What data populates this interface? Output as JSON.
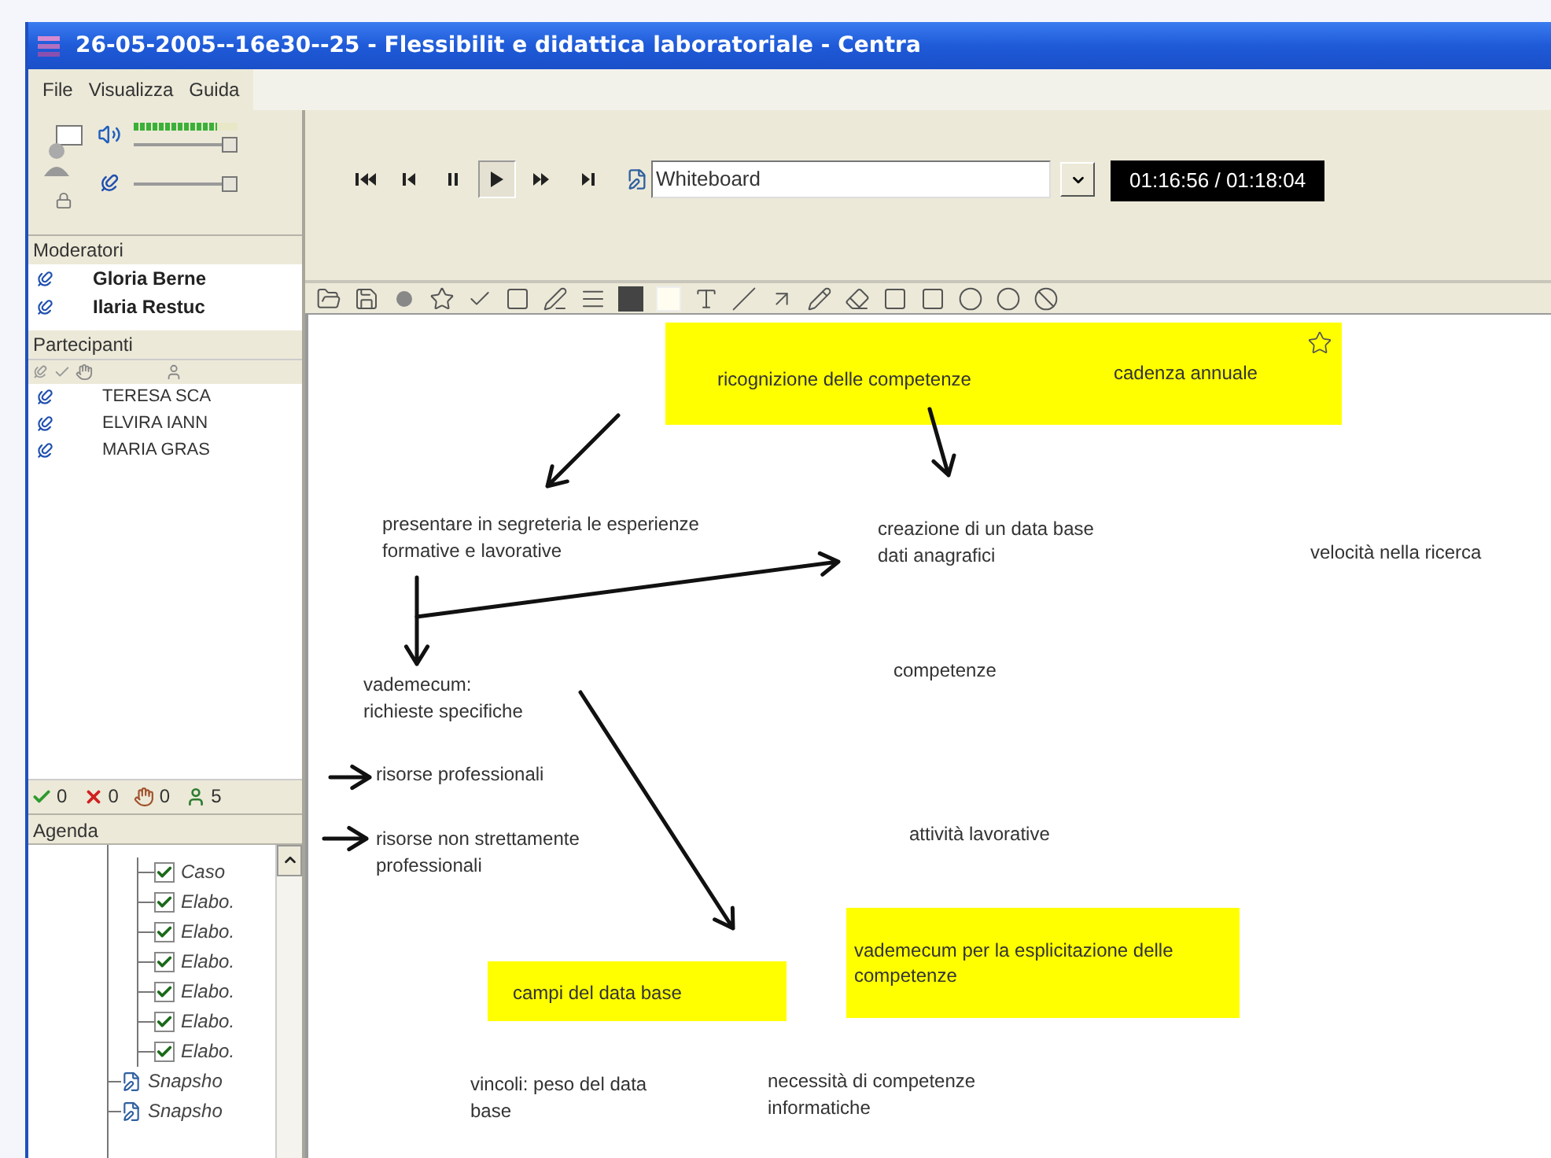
{
  "window": {
    "title": "26-05-2005--16e30--25 - Flessibilit e didattica laboratoriale - Centra"
  },
  "menu": [
    "File",
    "Visualizza",
    "Guida"
  ],
  "audio": {
    "meter": {
      "level": 0.8
    },
    "speaker": {
      "level": 1
    },
    "microphone": {
      "level": 1
    }
  },
  "moderators": {
    "title": "Moderatori",
    "items": [
      "Gloria Berne",
      "Ilaria Restuc"
    ]
  },
  "participants": {
    "title": "Partecipanti",
    "items": [
      "TERESA SCA",
      "ELVIRA IANN",
      "MARIA GRAS"
    ]
  },
  "status": [
    {
      "kind": "agree",
      "count": "0"
    },
    {
      "kind": "disagree",
      "count": "0"
    },
    {
      "kind": "hand",
      "count": "0"
    },
    {
      "kind": "people",
      "count": "5"
    }
  ],
  "agenda": {
    "title": "Agenda",
    "items": [
      {
        "kind": "group",
        "children": [
          {
            "label": "Caso",
            "checked": true
          },
          {
            "label": "Elabo.",
            "checked": true
          },
          {
            "label": "Elabo.",
            "checked": true
          },
          {
            "label": "Elabo.",
            "checked": true
          },
          {
            "label": "Elabo.",
            "checked": true
          },
          {
            "label": "Elabo.",
            "checked": true
          },
          {
            "label": "Elabo.",
            "checked": true
          }
        ]
      },
      {
        "kind": "snapshot",
        "label": "Snapsho"
      },
      {
        "kind": "snapshot",
        "label": "Snapsho"
      }
    ]
  },
  "playback": {
    "controls": [
      {
        "kind": "first",
        "selected": false
      },
      {
        "kind": "prev",
        "selected": false
      },
      {
        "kind": "pause",
        "selected": false
      },
      {
        "kind": "play",
        "selected": true
      },
      {
        "kind": "next",
        "selected": false
      },
      {
        "kind": "last",
        "selected": false
      }
    ],
    "view": {
      "value": "Whiteboard"
    },
    "time": "01:16:56 / 01:18:04"
  },
  "whiteboard": {
    "notes": [
      {
        "kind": "highlight",
        "texts": [
          "ricognizione delle competenze",
          "cadenza annuale"
        ]
      },
      {
        "kind": "text",
        "lines": [
          "presentare in segreteria le esperienze",
          "formative e lavorative"
        ]
      },
      {
        "kind": "text",
        "lines": [
          "creazione di un data base",
          "dati anagrafici"
        ]
      },
      {
        "kind": "text",
        "lines": [
          "velocità nella ricerca"
        ]
      },
      {
        "kind": "text",
        "lines": [
          "competenze"
        ]
      },
      {
        "kind": "text",
        "lines": [
          "vademecum:",
          "richieste specifiche"
        ]
      },
      {
        "kind": "text",
        "lines": [
          "risorse professionali"
        ]
      },
      {
        "kind": "text",
        "lines": [
          "risorse non strettamente",
          "professionali"
        ]
      },
      {
        "kind": "text",
        "lines": [
          "attività lavorative"
        ]
      },
      {
        "kind": "highlight",
        "texts": [
          "vademecum per la esplicitazione delle competenze"
        ]
      },
      {
        "kind": "highlight",
        "texts": [
          "campi del data base"
        ]
      },
      {
        "kind": "text",
        "lines": [
          "vincoli: peso del data",
          "base"
        ]
      },
      {
        "kind": "text",
        "lines": [
          "necessità di competenze",
          "informatiche"
        ]
      }
    ]
  }
}
